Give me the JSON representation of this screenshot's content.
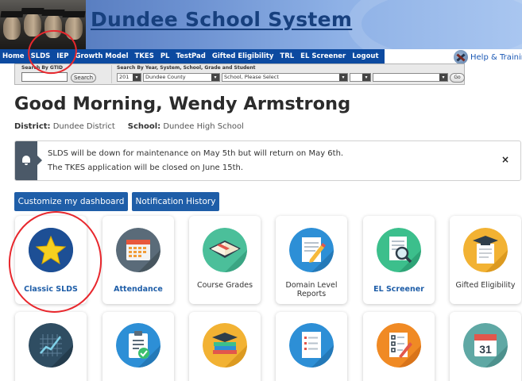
{
  "banner": {
    "title": "Dundee School System"
  },
  "nav": {
    "items": [
      "Home",
      "SLDS",
      "IEP",
      "Growth Model",
      "TKES",
      "PL",
      "TestPad",
      "Gifted Eligibility",
      "TRL",
      "EL Screener",
      "Logout"
    ],
    "help_label": "Help & Training"
  },
  "search": {
    "gtid_label": "Search By GTID",
    "gtid_button": "Search",
    "filters_label": "Search By Year, System, School, Grade and Student",
    "year_value": "201",
    "county_value": "Dundee County",
    "school_value": "School, Please Select",
    "go_label": "Go"
  },
  "greeting": {
    "text": "Good Morning, Wendy Armstrong",
    "district_label": "District:",
    "district_value": "Dundee District",
    "school_label": "School:",
    "school_value": "Dundee High School"
  },
  "alert": {
    "line1": "SLDS will be down for maintenance on May 5th but will return on May 6th.",
    "line2": "The TKES application will be closed on June 15th.",
    "close": "×"
  },
  "buttons": {
    "customize": "Customize my dashboard",
    "notifications": "Notification History"
  },
  "tiles_row1": [
    {
      "label": "Classic SLDS",
      "icon": "star-icon"
    },
    {
      "label": "Attendance",
      "icon": "calendar-grid-icon"
    },
    {
      "label": "Course Grades",
      "icon": "book-icon"
    },
    {
      "label": "Domain Level Reports",
      "icon": "document-pencil-icon"
    },
    {
      "label": "EL Screener",
      "icon": "document-magnifier-icon"
    },
    {
      "label": "Gifted Eligibility",
      "icon": "graduation-cap-paper-icon"
    }
  ],
  "tiles_row2": [
    {
      "icon": "graph-chart-icon"
    },
    {
      "icon": "clipboard-check-icon"
    },
    {
      "icon": "books-cap-icon"
    },
    {
      "icon": "list-document-icon"
    },
    {
      "icon": "checklist-pencil-icon"
    },
    {
      "icon": "calendar-date-icon",
      "date": "31"
    }
  ],
  "colors": {
    "nav_bg": "#0c4aa0",
    "button_bg": "#1f5ea8",
    "annotation_red": "#e8272d"
  }
}
